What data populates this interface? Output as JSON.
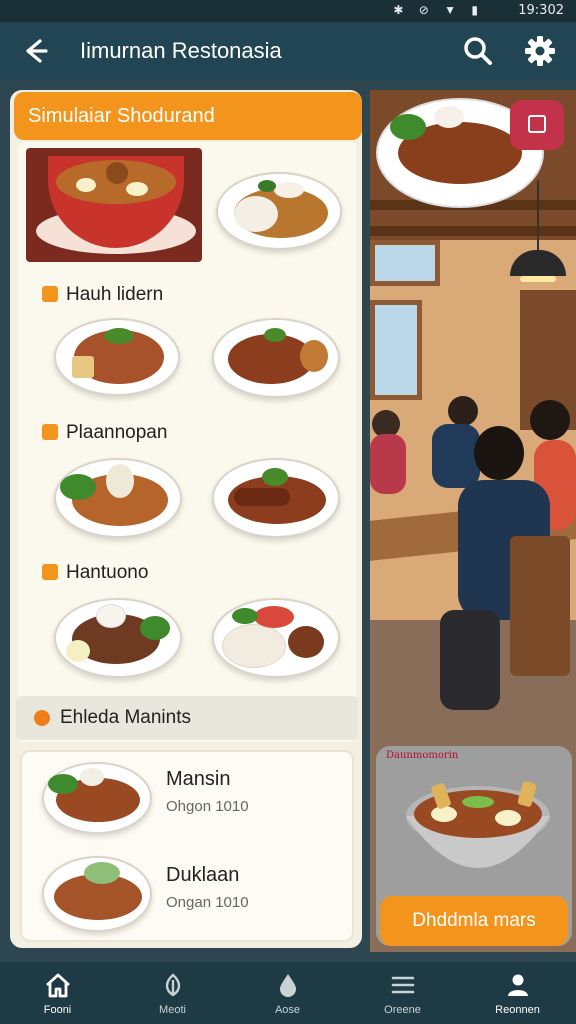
{
  "status_bar": {
    "time": "19:302",
    "icons": "✱ ⊘ ▼ ▮"
  },
  "app_bar": {
    "title": "Iimurnan Restonasia"
  },
  "left_panel": {
    "header": "Simulaiar Shodurand",
    "categories": [
      {
        "label": "Hauh lidern"
      },
      {
        "label": "Plaannopan"
      },
      {
        "label": "Hantuono"
      }
    ],
    "section_title": "Ehleda Manints",
    "featured": [
      {
        "name": "Mansin",
        "sub": "Ohgon 1010"
      },
      {
        "name": "Duklaan",
        "sub": "Ongan 1010"
      }
    ]
  },
  "right_panel": {
    "promo_tag": "Daunmomorin",
    "promo_button": "Dhddmla mars"
  },
  "bottom_nav": [
    {
      "label": "Fooni",
      "icon": "home-icon"
    },
    {
      "label": "Meoti",
      "icon": "leaf-icon"
    },
    {
      "label": "Aose",
      "icon": "drop-icon"
    },
    {
      "label": "Oreene",
      "icon": "menu-icon"
    },
    {
      "label": "Reonnen",
      "icon": "profile-icon"
    }
  ],
  "colors": {
    "accent": "#f3951c",
    "bar": "#214552",
    "panel": "#f3efe2",
    "bookmark": "#c2334a"
  }
}
